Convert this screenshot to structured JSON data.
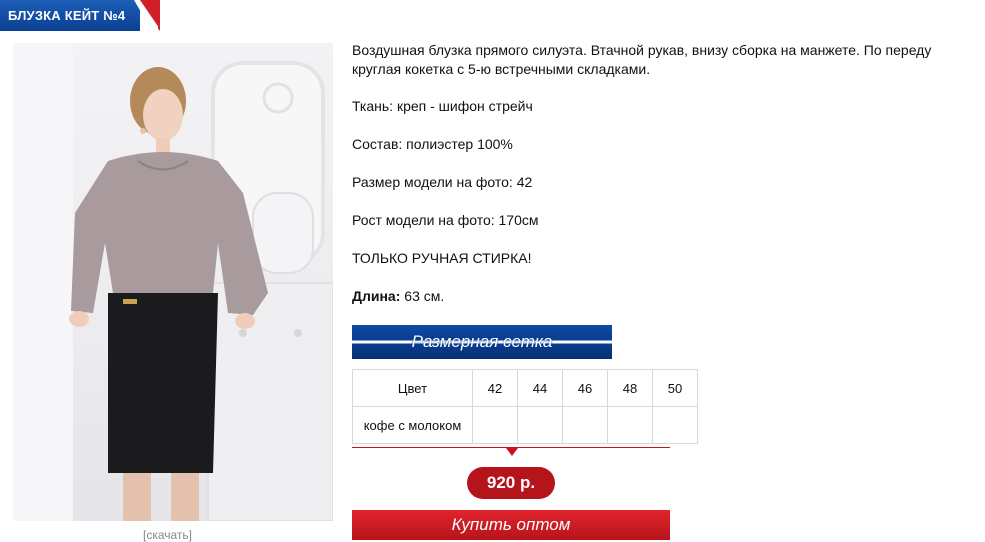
{
  "title": "БЛУЗКА КЕЙТ №4",
  "photo": {
    "zoom_label": "[скачать]"
  },
  "description": {
    "paragraph1_line1": "Воздушная блузка прямого силуэта. Втачной рукав, внизу сборка на манжете. По переду",
    "paragraph1_line2": "круглая кокетка с 5-ю встречными складками.",
    "fabric": "Ткань: креп - шифон стрейч",
    "composition": "Состав:  полиэстер 100%",
    "model_size": "Размер модели на фото: 42",
    "model_height": "Рост модели на фото: 170см",
    "wash": "ТОЛЬКО РУЧНАЯ СТИРКА!",
    "length_label": "Длина:",
    "length_value": " 63 см."
  },
  "size_chart_button": "Размерная сетка",
  "table": {
    "header": [
      "Цвет",
      "42",
      "44",
      "46",
      "48",
      "50"
    ],
    "rows": [
      {
        "color": "кофе с молоком",
        "cells": [
          "",
          "",
          "",
          "",
          ""
        ]
      }
    ]
  },
  "price": "920 р.",
  "buy_button": "Купить оптом",
  "colors": {
    "brand_blue": "#0a3d8f",
    "brand_red": "#c9141b",
    "blouse": "#a89a9d",
    "skirt": "#1b1b1e"
  }
}
